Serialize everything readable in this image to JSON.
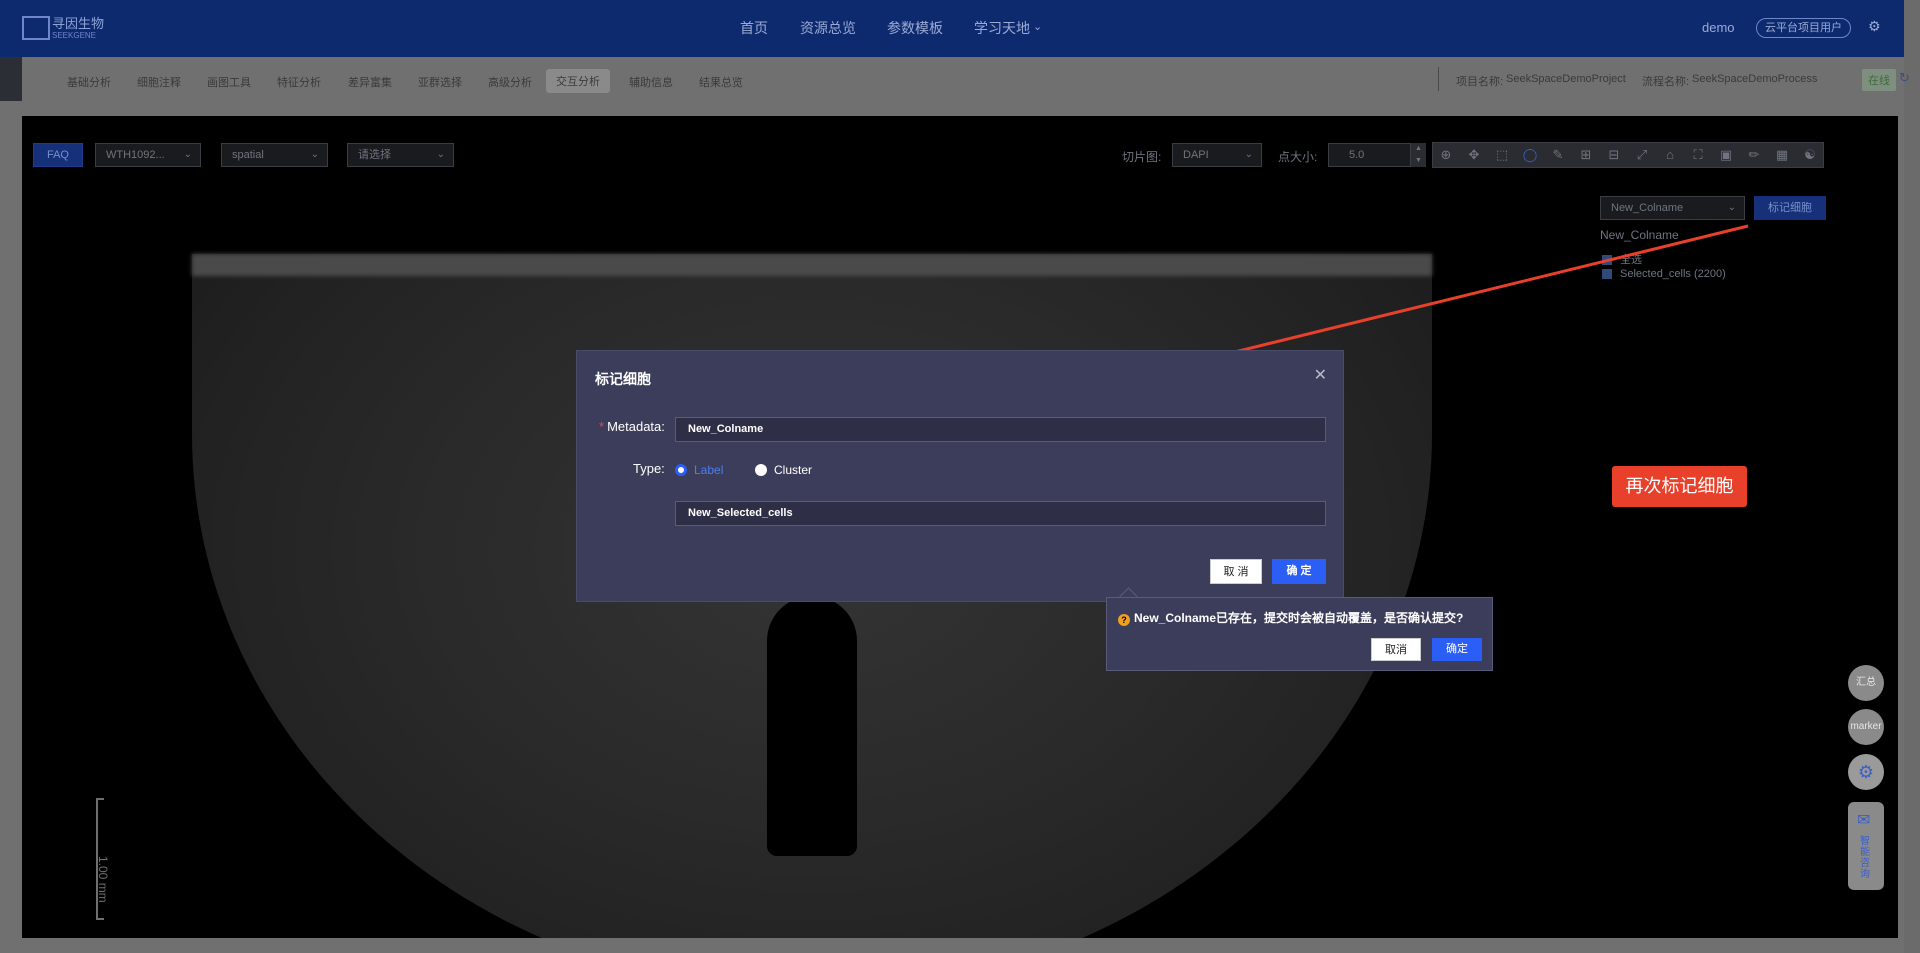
{
  "header": {
    "logo_name": "寻因生物",
    "logo_sub": "SEEKGENE",
    "nav": [
      "首页",
      "资源总览",
      "参数模板",
      "学习天地"
    ],
    "user": "demo",
    "user_badge": "云平台项目用户"
  },
  "subnav": {
    "tabs": [
      "基础分析",
      "细胞注释",
      "画图工具",
      "特征分析",
      "差异富集",
      "亚群选择",
      "高级分析",
      "交互分析",
      "辅助信息",
      "结果总览"
    ],
    "active_tab": "交互分析",
    "project_label": "项目名称:",
    "project_name": "SeekSpaceDemoProject",
    "process_label": "流程名称:",
    "process_name": "SeekSpaceDemoProcess",
    "status": "在线"
  },
  "controls": {
    "faq": "FAQ",
    "sample": "WTH1092...",
    "embedding": "spatial",
    "select_placeholder": "请选择",
    "slice_label": "切片图:",
    "slice_value": "DAPI",
    "point_size_label": "点大小:",
    "point_size": "5.0",
    "colname_select": "New_Colname",
    "mark_button": "标记细胞"
  },
  "legend": {
    "title": "New_Colname",
    "items": [
      {
        "label": "全选"
      },
      {
        "label": "Selected_cells (2200)"
      }
    ]
  },
  "scale_bar": "1.00 mm",
  "dialog": {
    "title": "标记细胞",
    "metadata_label": "Metadata:",
    "metadata_value": "New_Colname",
    "type_label": "Type:",
    "type_options": [
      "Label",
      "Cluster"
    ],
    "type_selected": "Label",
    "label_value": "New_Selected_cells",
    "cancel": "取 消",
    "ok": "确 定"
  },
  "popconfirm": {
    "message": "New_Colname已存在，提交时会被自动覆盖，是否确认提交?",
    "cancel": "取消",
    "ok": "确定"
  },
  "annotation": "再次标记细胞",
  "floating": {
    "summary": "汇总",
    "marker": "marker",
    "chat": "智能咨询"
  },
  "colors": {
    "header_bg": "#0e2a6e",
    "dialog_bg": "#3c3d5a",
    "primary": "#2a5ef5",
    "annotation": "#e8402a"
  }
}
